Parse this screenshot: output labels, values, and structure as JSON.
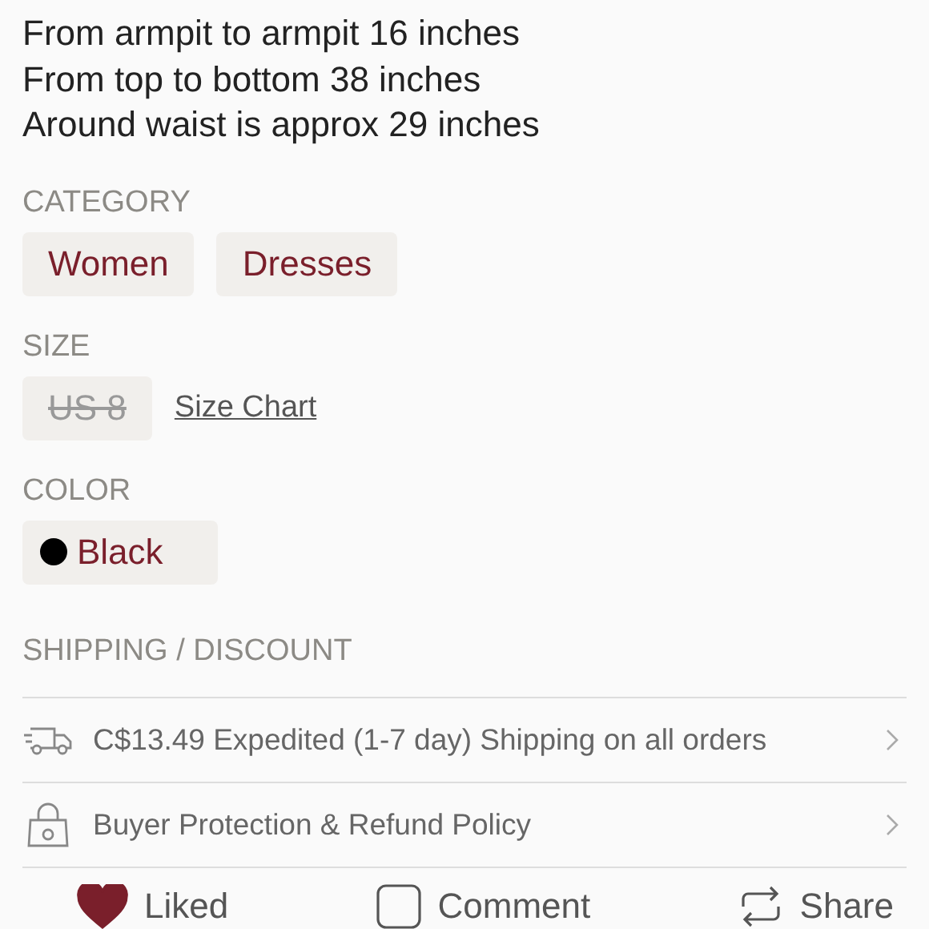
{
  "description": [
    "From armpit to armpit 16 inches",
    "From top to bottom 38 inches",
    "Around waist is approx 29 inches"
  ],
  "category": {
    "label": "CATEGORY",
    "chips": [
      "Women",
      "Dresses"
    ]
  },
  "size": {
    "label": "SIZE",
    "chips": [
      {
        "text": "US 8",
        "available": false
      }
    ],
    "link": "Size Chart"
  },
  "color": {
    "label": "COLOR",
    "chips": [
      {
        "text": "Black",
        "color": "#000000"
      }
    ]
  },
  "shipping": {
    "label": "SHIPPING / DISCOUNT",
    "rows": [
      {
        "kind": "truck",
        "text": "C$13.49 Expedited (1-7 day) Shipping on all orders"
      },
      {
        "kind": "lock",
        "text": "Buyer Protection & Refund Policy"
      }
    ]
  },
  "actions": [
    {
      "kind": "like",
      "label": "Liked",
      "on": true
    },
    {
      "kind": "comment",
      "label": "Comment"
    },
    {
      "kind": "share",
      "label": "Share"
    }
  ]
}
